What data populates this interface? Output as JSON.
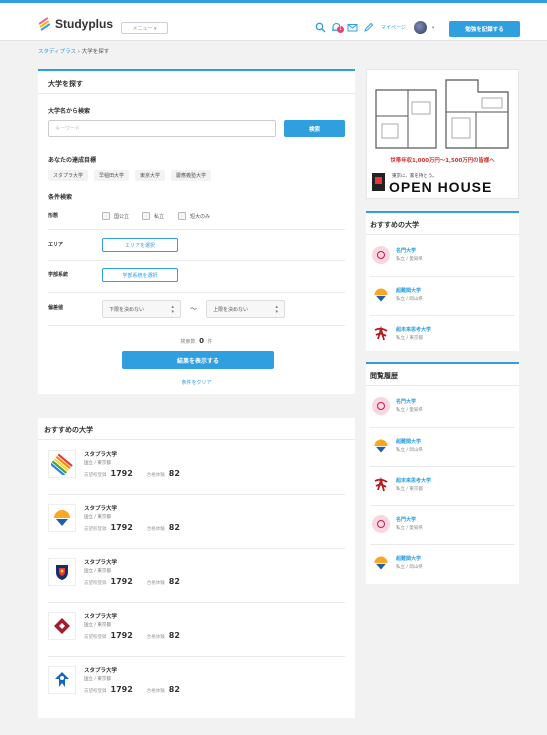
{
  "header": {
    "logo_text": "Studyplus",
    "menu_label": "メニュー ▾",
    "mypage_label": "マイページ",
    "notification_count": "1",
    "record_button": "勉強を記録する"
  },
  "breadcrumb": {
    "home": "スタディプラス",
    "separator": " › ",
    "current": "大学を探す"
  },
  "search": {
    "title": "大学を探す",
    "by_name_label": "大学名から検索",
    "keyword_placeholder": "キーワード",
    "search_button": "検索",
    "goals_label": "あなたの達成目標",
    "goals": [
      "スタプラ大学",
      "早稲田大学",
      "東京大学",
      "慶應義塾大学"
    ],
    "conditions_label": "条件検索",
    "type_label": "形態",
    "types": [
      "国公立",
      "私立",
      "短大のみ"
    ],
    "area_label": "エリア",
    "area_button": "エリアを選択",
    "faculty_label": "学部系統",
    "faculty_button": "学部系統を選択",
    "deviation_label": "偏差値",
    "lower_select": "下限を決めない",
    "upper_select": "上限を決めない",
    "range_tilde": "〜",
    "count_label": "検索数",
    "count_value": "0",
    "count_unit": "件",
    "show_results_button": "結果を表示する",
    "clear_link": "条件をクリア"
  },
  "recommended_main": {
    "title": "おすすめの大学",
    "items": [
      {
        "name": "スタプラ大学",
        "pref": "国立 / 東京都",
        "goal_label": "志望校登録",
        "goal_value": "1792",
        "pass_label": "合格体験",
        "pass_value": "82",
        "logo": "rainbow-stripes-logo"
      },
      {
        "name": "スタプラ大学",
        "pref": "国立 / 東京都",
        "goal_label": "志望校登録",
        "goal_value": "1792",
        "pass_label": "合格体験",
        "pass_value": "82",
        "logo": "sun-fan-logo"
      },
      {
        "name": "スタプラ大学",
        "pref": "国立 / 東京都",
        "goal_label": "志望校登録",
        "goal_value": "1792",
        "pass_label": "合格体験",
        "pass_value": "82",
        "logo": "shield-crest-logo"
      },
      {
        "name": "スタプラ大学",
        "pref": "国立 / 東京都",
        "goal_label": "志望校登録",
        "goal_value": "1792",
        "pass_label": "合格体験",
        "pass_value": "82",
        "logo": "red-diamond-logo"
      },
      {
        "name": "スタプラ大学",
        "pref": "国立 / 東京都",
        "goal_label": "志望校登録",
        "goal_value": "1792",
        "pass_label": "合格体験",
        "pass_value": "82",
        "logo": "blue-knot-logo"
      }
    ]
  },
  "ad": {
    "price_text": "世帯年収1,000万円〜1,500万円の皆様へ",
    "sub_text": "東京に、家を持とう。",
    "brand": "OPEN HOUSE"
  },
  "sidebar_recommended": {
    "title": "おすすめの大学",
    "items": [
      {
        "name": "名門大学",
        "pref": "私立 / 愛知県",
        "logo": "pink-emblem-logo"
      },
      {
        "name": "超難関大学",
        "pref": "私立 / 岡山県",
        "logo": "sun-fan-logo"
      },
      {
        "name": "超未来思考大学",
        "pref": "私立 / 東京都",
        "logo": "calligraphy-logo"
      }
    ]
  },
  "sidebar_history": {
    "title": "閲覧履歴",
    "items": [
      {
        "name": "名門大学",
        "pref": "私立 / 愛知県",
        "logo": "pink-emblem-logo"
      },
      {
        "name": "超難関大学",
        "pref": "私立 / 岡山県",
        "logo": "sun-fan-logo"
      },
      {
        "name": "超未来思考大学",
        "pref": "私立 / 東京都",
        "logo": "calligraphy-logo"
      },
      {
        "name": "名門大学",
        "pref": "私立 / 愛知県",
        "logo": "pink-emblem-logo"
      },
      {
        "name": "超難関大学",
        "pref": "私立 / 岡山県",
        "logo": "sun-fan-logo"
      }
    ]
  },
  "colors": {
    "accent": "#2f9fe0",
    "badge": "#e8416f"
  }
}
